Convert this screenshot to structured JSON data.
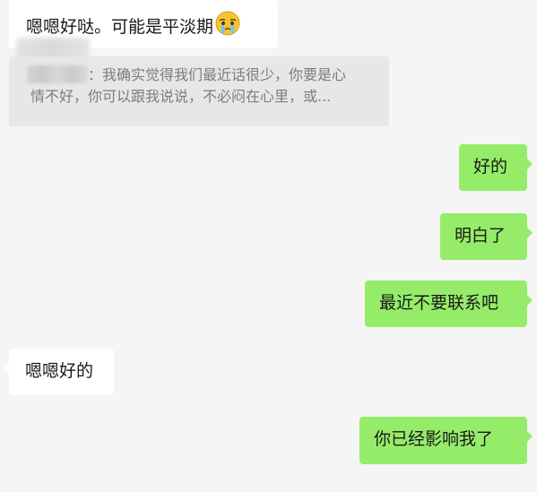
{
  "messages": [
    {
      "id": "m1",
      "side": "incoming",
      "text": "嗯嗯好哒。可能是平淡期",
      "emoji": "crying-face-emoji"
    },
    {
      "id": "m2",
      "side": "outgoing",
      "text": "好的"
    },
    {
      "id": "m3",
      "side": "outgoing",
      "text": "明白了"
    },
    {
      "id": "m4",
      "side": "outgoing",
      "text": "最近不要联系吧"
    },
    {
      "id": "m5",
      "side": "incoming",
      "text": "嗯嗯好的"
    },
    {
      "id": "m6",
      "side": "outgoing",
      "text": "你已经影响我了"
    }
  ],
  "quote": {
    "line1": "：我确实觉得我们最近话很少，你要是心",
    "line2": "情不好，你可以跟我说说，不必闷在心里，或..."
  },
  "colors": {
    "background": "#f5f5f5",
    "incoming_bubble": "#ffffff",
    "outgoing_bubble": "#95ec69",
    "quote_bg": "#e7e7e7",
    "quote_text": "#7c7c7c"
  }
}
